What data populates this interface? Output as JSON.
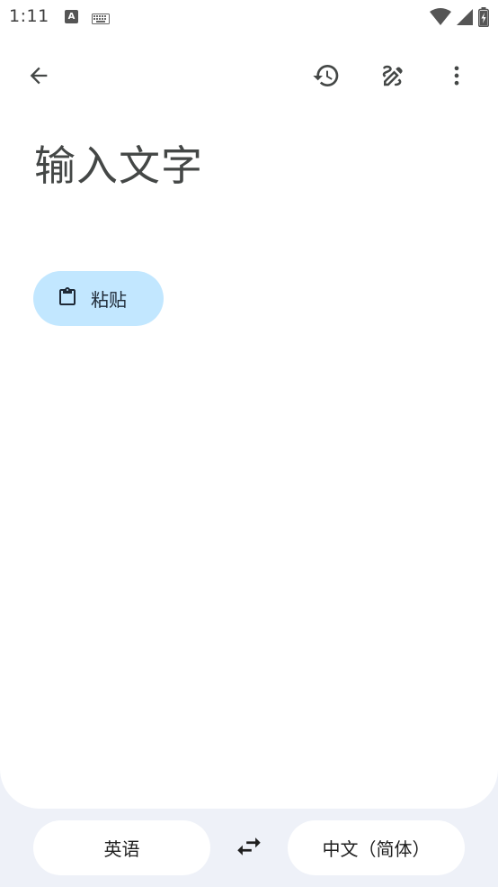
{
  "status_bar": {
    "time": "1:11",
    "notification_icons": [
      "text-a-icon",
      "keyboard-icon"
    ],
    "system_icons": [
      "wifi-icon",
      "signal-icon",
      "battery-charging-icon"
    ]
  },
  "toolbar": {
    "back_icon": "arrow-back-icon",
    "history_icon": "history-icon",
    "handwrite_icon": "draw-icon",
    "more_icon": "more-vert-icon"
  },
  "input": {
    "placeholder": "输入文字"
  },
  "paste": {
    "label": "粘贴",
    "icon": "clipboard-icon"
  },
  "language_bar": {
    "source": "英语",
    "target": "中文（简体）",
    "swap_icon": "swap-horiz-icon"
  },
  "colors": {
    "background": "#eef1f8",
    "surface": "#ffffff",
    "paste_chip": "#c2e7ff",
    "icon": "#444746"
  }
}
